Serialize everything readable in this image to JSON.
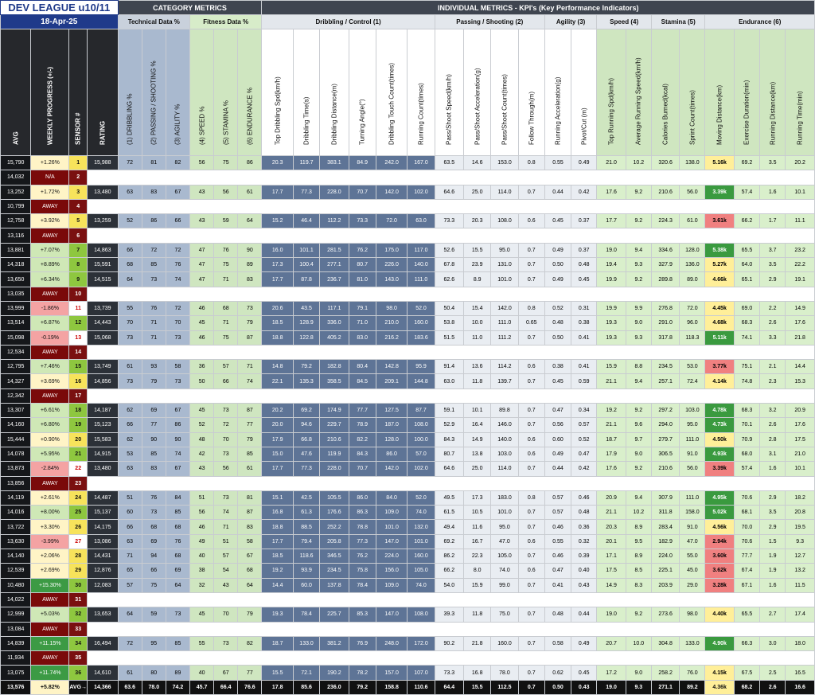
{
  "header": {
    "title": "DEV LEAGUE u10/11",
    "date": "18-Apr-25",
    "category_metrics": "CATEGORY  METRICS",
    "individual_metrics": "INDIVIDUAL METRICS - KPI's (Key Performance Indicators)",
    "technical": "Technical Data %",
    "fitness": "Fitness Data %",
    "groups": [
      "Dribbling / Control (1)",
      "Passing / Shooting (2)",
      "Agility (3)",
      "Speed (4)",
      "Stamina (5)",
      "Endurance (6)"
    ]
  },
  "columns": {
    "avg": "AVG",
    "weekly": "WEEKLY PROGRESS (+/-)",
    "sensor": "SENSOR #",
    "rating": "RATING",
    "cat": [
      "(1) DRIBBLING %",
      "(2) PASSING / SHOOTING %",
      "(3) AGILITY %",
      "(4) SPEED %",
      "(5) STAMINA %",
      "(6) ENDURANCE %"
    ],
    "kpi": [
      "Top Dribbling Spd(km/h)",
      "Dribbling Time(s)",
      "Dribbling Distance(m)",
      "Turning Angle(°)",
      "Dribbling Touch Count(times)",
      "Running Count(times)",
      "Pass/Shoot Speed(km/h)",
      "Pass/Shoot Acceleration(g)",
      "Pass/Shoot Count(times)",
      "Follow Through(m)",
      "Running Acceleration(g)",
      "Pivot/Cut (m)",
      "Top Running Spd(km/h)",
      "Average Running Speed(km/h)",
      "Calories Burned(kcal)",
      "Sprint Count(times)",
      "Moving Distance(km)",
      "Exercise Duration(min)",
      "Running Distance(km)",
      "Running Time(min)"
    ]
  },
  "rows": [
    {
      "avg": "15,790",
      "wp": "+1.26%",
      "s": "1",
      "r": "15,988",
      "c": [
        "72",
        "81",
        "82",
        "56",
        "75",
        "86"
      ],
      "k": [
        "20.3",
        "119.7",
        "383.1",
        "84.9",
        "242.0",
        "167.0",
        "63.5",
        "14.6",
        "153.0",
        "0.8",
        "0.55",
        "0.49",
        "21.0",
        "10.2",
        "320.6",
        "138.0",
        "5.16k",
        "69.2",
        "3.5",
        "20.2"
      ],
      "md": "mid"
    },
    {
      "avg": "14,032",
      "wp": "N/A",
      "s": "2",
      "away": true
    },
    {
      "avg": "13,252",
      "wp": "+1.72%",
      "s": "3",
      "r": "13,480",
      "c": [
        "63",
        "83",
        "67",
        "43",
        "56",
        "61"
      ],
      "k": [
        "17.7",
        "77.3",
        "228.0",
        "70.7",
        "142.0",
        "102.0",
        "64.6",
        "25.0",
        "114.0",
        "0.7",
        "0.44",
        "0.42",
        "17.6",
        "9.2",
        "210.6",
        "56.0",
        "3.39k",
        "57.4",
        "1.6",
        "10.1"
      ],
      "md": "hi"
    },
    {
      "avg": "10,799",
      "wp": "AWAY",
      "s": "4",
      "away": true
    },
    {
      "avg": "12,758",
      "wp": "+3.92%",
      "s": "5",
      "r": "13,259",
      "c": [
        "52",
        "86",
        "66",
        "43",
        "59",
        "64"
      ],
      "k": [
        "15.2",
        "46.4",
        "112.2",
        "73.3",
        "72.0",
        "63.0",
        "73.3",
        "20.3",
        "108.0",
        "0.6",
        "0.45",
        "0.37",
        "17.7",
        "9.2",
        "224.3",
        "61.0",
        "3.61k",
        "66.2",
        "1.7",
        "11.1"
      ],
      "md": "lo"
    },
    {
      "avg": "13,116",
      "wp": "AWAY",
      "s": "6",
      "away": true
    },
    {
      "avg": "13,881",
      "wp": "+7.07%",
      "s": "7",
      "r": "14,863",
      "c": [
        "66",
        "72",
        "72",
        "47",
        "76",
        "90"
      ],
      "k": [
        "16.0",
        "101.1",
        "281.5",
        "76.2",
        "175.0",
        "117.0",
        "52.6",
        "15.5",
        "95.0",
        "0.7",
        "0.49",
        "0.37",
        "19.0",
        "9.4",
        "334.6",
        "128.0",
        "5.38k",
        "65.5",
        "3.7",
        "23.2"
      ],
      "md": "hi"
    },
    {
      "avg": "14,318",
      "wp": "+8.89%",
      "s": "8",
      "r": "15,591",
      "c": [
        "68",
        "85",
        "76",
        "47",
        "75",
        "89"
      ],
      "k": [
        "17.3",
        "100.4",
        "277.1",
        "80.7",
        "226.0",
        "140.0",
        "67.8",
        "23.9",
        "131.0",
        "0.7",
        "0.50",
        "0.48",
        "19.4",
        "9.3",
        "327.9",
        "136.0",
        "5.27k",
        "64.0",
        "3.5",
        "22.2"
      ],
      "md": "mid"
    },
    {
      "avg": "13,650",
      "wp": "+6.34%",
      "s": "9",
      "r": "14,515",
      "c": [
        "64",
        "73",
        "74",
        "47",
        "71",
        "83"
      ],
      "k": [
        "17.7",
        "87.8",
        "236.7",
        "81.0",
        "143.0",
        "111.0",
        "62.6",
        "8.9",
        "101.0",
        "0.7",
        "0.49",
        "0.45",
        "19.9",
        "9.2",
        "289.8",
        "89.0",
        "4.66k",
        "65.1",
        "2.9",
        "19.1"
      ],
      "md": "mid"
    },
    {
      "avg": "13,035",
      "wp": "AWAY",
      "s": "10",
      "away": true
    },
    {
      "avg": "13,999",
      "wp": "-1.86%",
      "s": "11",
      "r": "13,739",
      "c": [
        "55",
        "76",
        "72",
        "46",
        "68",
        "73"
      ],
      "k": [
        "20.6",
        "43.5",
        "117.1",
        "79.1",
        "98.0",
        "52.0",
        "50.4",
        "15.4",
        "142.0",
        "0.8",
        "0.52",
        "0.31",
        "19.9",
        "9.9",
        "276.8",
        "72.0",
        "4.45k",
        "69.0",
        "2.2",
        "14.9"
      ],
      "md": "mid"
    },
    {
      "avg": "13,514",
      "wp": "+6.87%",
      "s": "12",
      "r": "14,443",
      "c": [
        "70",
        "71",
        "70",
        "45",
        "71",
        "79"
      ],
      "k": [
        "18.5",
        "128.9",
        "336.0",
        "71.0",
        "210.0",
        "160.0",
        "53.8",
        "10.0",
        "111.0",
        "0.65",
        "0.48",
        "0.38",
        "19.3",
        "9.0",
        "291.0",
        "96.0",
        "4.68k",
        "68.3",
        "2.6",
        "17.6"
      ],
      "md": "mid"
    },
    {
      "avg": "15,098",
      "wp": "-0.19%",
      "s": "13",
      "r": "15,068",
      "c": [
        "73",
        "71",
        "73",
        "46",
        "75",
        "87"
      ],
      "k": [
        "18.8",
        "122.8",
        "405.2",
        "83.0",
        "216.2",
        "183.6",
        "51.5",
        "11.0",
        "111.2",
        "0.7",
        "0.50",
        "0.41",
        "19.3",
        "9.3",
        "317.8",
        "118.3",
        "5.11k",
        "74.1",
        "3.3",
        "21.8"
      ],
      "md": "hi"
    },
    {
      "avg": "12,534",
      "wp": "AWAY",
      "s": "14",
      "away": true
    },
    {
      "avg": "12,795",
      "wp": "+7.46%",
      "s": "15",
      "r": "13,749",
      "c": [
        "61",
        "93",
        "58",
        "36",
        "57",
        "71"
      ],
      "k": [
        "14.8",
        "79.2",
        "182.8",
        "80.4",
        "142.8",
        "95.9",
        "91.4",
        "13.6",
        "114.2",
        "0.6",
        "0.38",
        "0.41",
        "15.9",
        "8.8",
        "234.5",
        "53.0",
        "3.77k",
        "75.1",
        "2.1",
        "14.4"
      ],
      "md": "lo"
    },
    {
      "avg": "14,327",
      "wp": "+3.69%",
      "s": "16",
      "r": "14,856",
      "c": [
        "73",
        "79",
        "73",
        "50",
        "66",
        "74"
      ],
      "k": [
        "22.1",
        "135.3",
        "358.5",
        "84.5",
        "209.1",
        "144.8",
        "63.0",
        "11.8",
        "139.7",
        "0.7",
        "0.45",
        "0.59",
        "21.1",
        "9.4",
        "257.1",
        "72.4",
        "4.14k",
        "74.8",
        "2.3",
        "15.3"
      ],
      "md": "mid"
    },
    {
      "avg": "12,342",
      "wp": "AWAY",
      "s": "17",
      "away": true
    },
    {
      "avg": "13,307",
      "wp": "+6.61%",
      "s": "18",
      "r": "14,187",
      "c": [
        "62",
        "69",
        "67",
        "45",
        "73",
        "87"
      ],
      "k": [
        "20.2",
        "69.2",
        "174.9",
        "77.7",
        "127.5",
        "87.7",
        "59.1",
        "10.1",
        "89.8",
        "0.7",
        "0.47",
        "0.34",
        "19.2",
        "9.2",
        "297.2",
        "103.0",
        "4.78k",
        "68.3",
        "3.2",
        "20.9"
      ],
      "md": "hi"
    },
    {
      "avg": "14,160",
      "wp": "+6.80%",
      "s": "19",
      "r": "15,123",
      "c": [
        "66",
        "77",
        "86",
        "52",
        "72",
        "77"
      ],
      "k": [
        "20.0",
        "94.6",
        "229.7",
        "78.9",
        "187.0",
        "108.0",
        "52.9",
        "16.4",
        "146.0",
        "0.7",
        "0.56",
        "0.57",
        "21.1",
        "9.6",
        "294.0",
        "95.0",
        "4.73k",
        "70.1",
        "2.6",
        "17.6"
      ],
      "md": "hi"
    },
    {
      "avg": "15,444",
      "wp": "+0.90%",
      "s": "20",
      "r": "15,583",
      "c": [
        "62",
        "90",
        "90",
        "48",
        "70",
        "79"
      ],
      "k": [
        "17.9",
        "66.8",
        "210.6",
        "82.2",
        "128.0",
        "100.0",
        "84.3",
        "14.9",
        "140.0",
        "0.6",
        "0.60",
        "0.52",
        "18.7",
        "9.7",
        "279.7",
        "111.0",
        "4.50k",
        "70.9",
        "2.8",
        "17.5"
      ],
      "md": "mid"
    },
    {
      "avg": "14,078",
      "wp": "+5.95%",
      "s": "21",
      "r": "14,915",
      "c": [
        "53",
        "85",
        "74",
        "42",
        "73",
        "85"
      ],
      "k": [
        "15.0",
        "47.6",
        "119.9",
        "84.3",
        "86.0",
        "57.0",
        "80.7",
        "13.8",
        "103.0",
        "0.6",
        "0.49",
        "0.47",
        "17.9",
        "9.0",
        "306.5",
        "91.0",
        "4.93k",
        "68.0",
        "3.1",
        "21.0"
      ],
      "md": "hi"
    },
    {
      "avg": "13,873",
      "wp": "-2.84%",
      "s": "22",
      "r": "13,480",
      "c": [
        "63",
        "83",
        "67",
        "43",
        "56",
        "61"
      ],
      "k": [
        "17.7",
        "77.3",
        "228.0",
        "70.7",
        "142.0",
        "102.0",
        "64.6",
        "25.0",
        "114.0",
        "0.7",
        "0.44",
        "0.42",
        "17.6",
        "9.2",
        "210.6",
        "56.0",
        "3.39k",
        "57.4",
        "1.6",
        "10.1"
      ],
      "md": "lo"
    },
    {
      "avg": "13,856",
      "wp": "AWAY",
      "s": "23",
      "away": true
    },
    {
      "avg": "14,119",
      "wp": "+2.61%",
      "s": "24",
      "r": "14,487",
      "c": [
        "51",
        "76",
        "84",
        "51",
        "73",
        "81"
      ],
      "k": [
        "15.1",
        "42.5",
        "105.5",
        "86.0",
        "84.0",
        "52.0",
        "49.5",
        "17.3",
        "183.0",
        "0.8",
        "0.57",
        "0.46",
        "20.9",
        "9.4",
        "307.9",
        "111.0",
        "4.95k",
        "70.6",
        "2.9",
        "18.2"
      ],
      "md": "hi"
    },
    {
      "avg": "14,016",
      "wp": "+8.00%",
      "s": "25",
      "r": "15,137",
      "c": [
        "60",
        "73",
        "85",
        "56",
        "74",
        "87"
      ],
      "k": [
        "16.8",
        "61.3",
        "176.6",
        "86.3",
        "109.0",
        "74.0",
        "61.5",
        "10.5",
        "101.0",
        "0.7",
        "0.57",
        "0.48",
        "21.1",
        "10.2",
        "311.8",
        "158.0",
        "5.02k",
        "68.1",
        "3.5",
        "20.8"
      ],
      "md": "hi"
    },
    {
      "avg": "13,722",
      "wp": "+3.30%",
      "s": "26",
      "r": "14,175",
      "c": [
        "66",
        "68",
        "68",
        "46",
        "71",
        "83"
      ],
      "k": [
        "18.8",
        "88.5",
        "252.2",
        "78.8",
        "101.0",
        "132.0",
        "49.4",
        "11.6",
        "95.0",
        "0.7",
        "0.46",
        "0.36",
        "20.3",
        "8.9",
        "283.4",
        "91.0",
        "4.56k",
        "70.0",
        "2.9",
        "19.5"
      ],
      "md": "mid"
    },
    {
      "avg": "13,630",
      "wp": "-3.99%",
      "s": "27",
      "r": "13,086",
      "c": [
        "63",
        "69",
        "76",
        "49",
        "51",
        "58"
      ],
      "k": [
        "17.7",
        "79.4",
        "205.8",
        "77.3",
        "147.0",
        "101.0",
        "69.2",
        "16.7",
        "47.0",
        "0.6",
        "0.55",
        "0.32",
        "20.1",
        "9.5",
        "182.9",
        "47.0",
        "2.94k",
        "70.6",
        "1.5",
        "9.3"
      ],
      "md": "lo"
    },
    {
      "avg": "14,140",
      "wp": "+2.06%",
      "s": "28",
      "r": "14,431",
      "c": [
        "71",
        "94",
        "68",
        "40",
        "57",
        "67"
      ],
      "k": [
        "18.5",
        "118.6",
        "346.5",
        "76.2",
        "224.0",
        "160.0",
        "86.2",
        "22.3",
        "105.0",
        "0.7",
        "0.46",
        "0.39",
        "17.1",
        "8.9",
        "224.0",
        "55.0",
        "3.60k",
        "77.7",
        "1.9",
        "12.7"
      ],
      "md": "lo"
    },
    {
      "avg": "12,539",
      "wp": "+2.69%",
      "s": "29",
      "r": "12,876",
      "c": [
        "65",
        "66",
        "69",
        "38",
        "54",
        "68"
      ],
      "k": [
        "19.2",
        "93.9",
        "234.5",
        "75.8",
        "156.0",
        "105.0",
        "66.2",
        "8.0",
        "74.0",
        "0.6",
        "0.47",
        "0.40",
        "17.5",
        "8.5",
        "225.1",
        "45.0",
        "3.62k",
        "67.4",
        "1.9",
        "13.2"
      ],
      "md": "lo"
    },
    {
      "avg": "10,480",
      "wp": "+15.30%",
      "s": "30",
      "r": "12,083",
      "c": [
        "57",
        "75",
        "64",
        "32",
        "43",
        "64"
      ],
      "k": [
        "14.4",
        "60.0",
        "137.8",
        "78.4",
        "109.0",
        "74.0",
        "54.0",
        "15.9",
        "99.0",
        "0.7",
        "0.41",
        "0.43",
        "14.9",
        "8.3",
        "203.9",
        "29.0",
        "3.28k",
        "67.1",
        "1.6",
        "11.5"
      ],
      "md": "lo"
    },
    {
      "avg": "14,022",
      "wp": "AWAY",
      "s": "31",
      "away": true
    },
    {
      "avg": "12,999",
      "wp": "+5.03%",
      "s": "32",
      "r": "13,653",
      "c": [
        "64",
        "59",
        "73",
        "45",
        "70",
        "79"
      ],
      "k": [
        "19.3",
        "78.4",
        "225.7",
        "85.3",
        "147.0",
        "108.0",
        "39.3",
        "11.8",
        "75.0",
        "0.7",
        "0.48",
        "0.44",
        "19.0",
        "9.2",
        "273.6",
        "98.0",
        "4.40k",
        "65.5",
        "2.7",
        "17.4"
      ],
      "md": "mid"
    },
    {
      "avg": "13,084",
      "wp": "AWAY",
      "s": "33",
      "away": true
    },
    {
      "avg": "14,839",
      "wp": "+11.15%",
      "s": "34",
      "r": "16,494",
      "c": [
        "72",
        "95",
        "85",
        "55",
        "73",
        "82"
      ],
      "k": [
        "18.7",
        "133.0",
        "381.2",
        "76.9",
        "248.0",
        "172.0",
        "90.2",
        "21.8",
        "160.0",
        "0.7",
        "0.58",
        "0.49",
        "20.7",
        "10.0",
        "304.8",
        "133.0",
        "4.90k",
        "66.3",
        "3.0",
        "18.0"
      ],
      "md": "hi"
    },
    {
      "avg": "11,934",
      "wp": "AWAY",
      "s": "35",
      "away": true
    },
    {
      "avg": "13,075",
      "wp": "+11.74%",
      "s": "36",
      "r": "14,610",
      "c": [
        "61",
        "80",
        "89",
        "40",
        "67",
        "77"
      ],
      "k": [
        "15.5",
        "72.1",
        "190.2",
        "78.2",
        "157.0",
        "107.0",
        "73.3",
        "16.8",
        "78.0",
        "0.7",
        "0.62",
        "0.45",
        "17.2",
        "9.0",
        "258.2",
        "76.0",
        "4.15k",
        "67.5",
        "2.5",
        "16.5"
      ],
      "md": "mid"
    }
  ],
  "footer": {
    "avg": "13,576",
    "wp": "+5.82%",
    "s": "AVG→",
    "r": "14,366",
    "c": [
      "63.6",
      "78.0",
      "74.2",
      "45.7",
      "66.4",
      "76.6"
    ],
    "k": [
      "17.8",
      "85.6",
      "236.0",
      "79.2",
      "158.8",
      "110.6",
      "64.4",
      "15.5",
      "112.5",
      "0.7",
      "0.50",
      "0.43",
      "19.0",
      "9.3",
      "271.1",
      "89.2",
      "4.36k",
      "68.2",
      "2.6",
      "16.6"
    ]
  },
  "colors": {
    "sensor_green": "#8ec73f",
    "sensor_yellow": "#f7e35b",
    "sensor_red": "#7a1010",
    "md_high": "#3a9a3f",
    "md_mid": "#ffef99",
    "md_low": "#f08080"
  }
}
